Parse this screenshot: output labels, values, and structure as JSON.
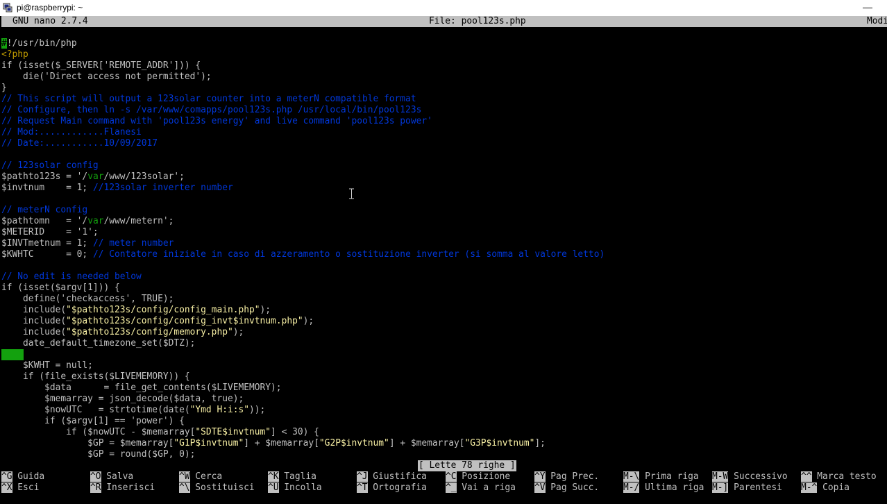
{
  "window": {
    "title": "pi@raspberrypi: ~",
    "minimize_label": "—"
  },
  "nano": {
    "version": "GNU nano 2.7.4",
    "file": "File: pool123s.php",
    "mode": "Modi"
  },
  "lines": [
    {
      "cursor": "#",
      "text": "!/usr/bin/php"
    },
    {
      "tag": "<?php"
    },
    {
      "text": "if (isset($_SERVER['REMOTE_ADDR'])) {"
    },
    {
      "text": "    die('Direct access not permitted');"
    },
    {
      "text": "}"
    },
    {
      "comment": "// This script will output a 123solar counter into a meterN compatible format"
    },
    {
      "comment": "// Configure, then ln -s /var/www/comapps/pool123s.php /usr/local/bin/pool123s"
    },
    {
      "comment": "// Request Main command with 'pool123s energy' and live command 'pool123s power'"
    },
    {
      "comment": "// Mod:............Flanesi"
    },
    {
      "comment": "// Date:...........10/09/2017"
    },
    {
      "text": ""
    },
    {
      "comment": "// 123solar config"
    },
    {
      "a": "$pathto123s = '/",
      "dir": "var",
      "b": "/www/123solar';"
    },
    {
      "text": "$invtnum    = 1; ",
      "comment": "//123solar inverter number"
    },
    {
      "text": ""
    },
    {
      "comment": "// meterN config"
    },
    {
      "a": "$pathtomn   = '/",
      "dir": "var",
      "b": "/www/metern';"
    },
    {
      "text": "$METERID    = '1';"
    },
    {
      "text": "$INVTmetnum = 1; ",
      "comment": "// meter number"
    },
    {
      "text": "$KWHTC      = 0; ",
      "comment": "// Contatore iniziale in caso di azzeramento o sostituzione inverter (si somma al valore letto)"
    },
    {
      "text": ""
    },
    {
      "comment": "// No edit is needed below"
    },
    {
      "text": "if (isset($argv[1])) {"
    },
    {
      "text": "    define('checkaccess', TRUE);"
    },
    {
      "a": "    include(",
      "str": "\"$pathto123s/config/config_main.php\"",
      "b": ");"
    },
    {
      "a": "    include(",
      "str": "\"$pathto123s/config/config_invt$invtnum.php\"",
      "b": ");"
    },
    {
      "a": "    include(",
      "str": "\"$pathto123s/config/memory.php\"",
      "b": ");"
    },
    {
      "text": "    date_default_timezone_set($DTZ);"
    },
    {
      "ws": true
    },
    {
      "text": "    $KWHT = null;"
    },
    {
      "text": "    if (file_exists($LIVEMEMORY)) {"
    },
    {
      "text": "        $data      = file_get_contents($LIVEMEMORY);"
    },
    {
      "text": "        $memarray = json_decode($data, true);"
    },
    {
      "a": "        $nowUTC   = strtotime(date(",
      "str": "\"Ymd H:i:s\"",
      "b": "));"
    },
    {
      "text": "        if ($argv[1] == 'power') {"
    },
    {
      "a": "            if ($nowUTC - $memarray[",
      "str": "\"SDTE$invtnum\"",
      "b": "] < 30) {"
    },
    {
      "a": "                $GP = $memarray[",
      "str": "\"G1P$invtnum\"",
      "b": "] + $memarray[",
      "str2": "\"G2P$invtnum\"",
      "c": "] + $memarray[",
      "str3": "\"G3P$invtnum\"",
      "d": "];"
    },
    {
      "text": "                $GP = round($GP, 0);"
    }
  ],
  "status": "[ Lette 78 righe ]",
  "shortcuts_row1": [
    {
      "key": "^G",
      "label": "Guida"
    },
    {
      "key": "^O",
      "label": "Salva"
    },
    {
      "key": "^W",
      "label": "Cerca"
    },
    {
      "key": "^K",
      "label": "Taglia"
    },
    {
      "key": "^J",
      "label": "Giustifica"
    },
    {
      "key": "^C",
      "label": "Posizione"
    },
    {
      "key": "^Y",
      "label": "Pag Prec."
    },
    {
      "key": "M-\\",
      "label": "Prima riga"
    },
    {
      "key": "M-W",
      "label": "Successivo"
    },
    {
      "key": "^^",
      "label": "Marca testo"
    }
  ],
  "shortcuts_row2": [
    {
      "key": "^X",
      "label": "Esci"
    },
    {
      "key": "^R",
      "label": "Inserisci"
    },
    {
      "key": "^\\",
      "label": "Sostituisci"
    },
    {
      "key": "^U",
      "label": "Incolla"
    },
    {
      "key": "^T",
      "label": "Ortografia"
    },
    {
      "key": "^_",
      "label": "Vai a riga"
    },
    {
      "key": "^V",
      "label": "Pag Succ."
    },
    {
      "key": "M-/",
      "label": "Ultima riga"
    },
    {
      "key": "M-]",
      "label": "Parentesi"
    },
    {
      "key": "M-^",
      "label": "Copia"
    }
  ]
}
